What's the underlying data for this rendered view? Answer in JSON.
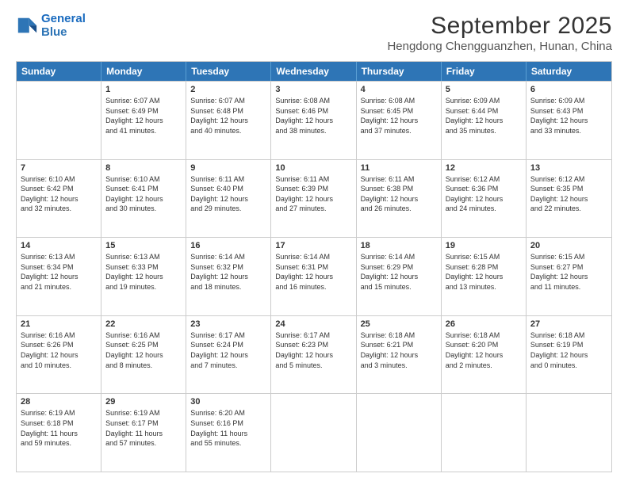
{
  "logo": {
    "line1": "General",
    "line2": "Blue"
  },
  "title": "September 2025",
  "location": "Hengdong Chengguanzhen, Hunan, China",
  "days_of_week": [
    "Sunday",
    "Monday",
    "Tuesday",
    "Wednesday",
    "Thursday",
    "Friday",
    "Saturday"
  ],
  "weeks": [
    [
      {
        "day": "",
        "info": ""
      },
      {
        "day": "1",
        "info": "Sunrise: 6:07 AM\nSunset: 6:49 PM\nDaylight: 12 hours\nand 41 minutes."
      },
      {
        "day": "2",
        "info": "Sunrise: 6:07 AM\nSunset: 6:48 PM\nDaylight: 12 hours\nand 40 minutes."
      },
      {
        "day": "3",
        "info": "Sunrise: 6:08 AM\nSunset: 6:46 PM\nDaylight: 12 hours\nand 38 minutes."
      },
      {
        "day": "4",
        "info": "Sunrise: 6:08 AM\nSunset: 6:45 PM\nDaylight: 12 hours\nand 37 minutes."
      },
      {
        "day": "5",
        "info": "Sunrise: 6:09 AM\nSunset: 6:44 PM\nDaylight: 12 hours\nand 35 minutes."
      },
      {
        "day": "6",
        "info": "Sunrise: 6:09 AM\nSunset: 6:43 PM\nDaylight: 12 hours\nand 33 minutes."
      }
    ],
    [
      {
        "day": "7",
        "info": "Sunrise: 6:10 AM\nSunset: 6:42 PM\nDaylight: 12 hours\nand 32 minutes."
      },
      {
        "day": "8",
        "info": "Sunrise: 6:10 AM\nSunset: 6:41 PM\nDaylight: 12 hours\nand 30 minutes."
      },
      {
        "day": "9",
        "info": "Sunrise: 6:11 AM\nSunset: 6:40 PM\nDaylight: 12 hours\nand 29 minutes."
      },
      {
        "day": "10",
        "info": "Sunrise: 6:11 AM\nSunset: 6:39 PM\nDaylight: 12 hours\nand 27 minutes."
      },
      {
        "day": "11",
        "info": "Sunrise: 6:11 AM\nSunset: 6:38 PM\nDaylight: 12 hours\nand 26 minutes."
      },
      {
        "day": "12",
        "info": "Sunrise: 6:12 AM\nSunset: 6:36 PM\nDaylight: 12 hours\nand 24 minutes."
      },
      {
        "day": "13",
        "info": "Sunrise: 6:12 AM\nSunset: 6:35 PM\nDaylight: 12 hours\nand 22 minutes."
      }
    ],
    [
      {
        "day": "14",
        "info": "Sunrise: 6:13 AM\nSunset: 6:34 PM\nDaylight: 12 hours\nand 21 minutes."
      },
      {
        "day": "15",
        "info": "Sunrise: 6:13 AM\nSunset: 6:33 PM\nDaylight: 12 hours\nand 19 minutes."
      },
      {
        "day": "16",
        "info": "Sunrise: 6:14 AM\nSunset: 6:32 PM\nDaylight: 12 hours\nand 18 minutes."
      },
      {
        "day": "17",
        "info": "Sunrise: 6:14 AM\nSunset: 6:31 PM\nDaylight: 12 hours\nand 16 minutes."
      },
      {
        "day": "18",
        "info": "Sunrise: 6:14 AM\nSunset: 6:29 PM\nDaylight: 12 hours\nand 15 minutes."
      },
      {
        "day": "19",
        "info": "Sunrise: 6:15 AM\nSunset: 6:28 PM\nDaylight: 12 hours\nand 13 minutes."
      },
      {
        "day": "20",
        "info": "Sunrise: 6:15 AM\nSunset: 6:27 PM\nDaylight: 12 hours\nand 11 minutes."
      }
    ],
    [
      {
        "day": "21",
        "info": "Sunrise: 6:16 AM\nSunset: 6:26 PM\nDaylight: 12 hours\nand 10 minutes."
      },
      {
        "day": "22",
        "info": "Sunrise: 6:16 AM\nSunset: 6:25 PM\nDaylight: 12 hours\nand 8 minutes."
      },
      {
        "day": "23",
        "info": "Sunrise: 6:17 AM\nSunset: 6:24 PM\nDaylight: 12 hours\nand 7 minutes."
      },
      {
        "day": "24",
        "info": "Sunrise: 6:17 AM\nSunset: 6:23 PM\nDaylight: 12 hours\nand 5 minutes."
      },
      {
        "day": "25",
        "info": "Sunrise: 6:18 AM\nSunset: 6:21 PM\nDaylight: 12 hours\nand 3 minutes."
      },
      {
        "day": "26",
        "info": "Sunrise: 6:18 AM\nSunset: 6:20 PM\nDaylight: 12 hours\nand 2 minutes."
      },
      {
        "day": "27",
        "info": "Sunrise: 6:18 AM\nSunset: 6:19 PM\nDaylight: 12 hours\nand 0 minutes."
      }
    ],
    [
      {
        "day": "28",
        "info": "Sunrise: 6:19 AM\nSunset: 6:18 PM\nDaylight: 11 hours\nand 59 minutes."
      },
      {
        "day": "29",
        "info": "Sunrise: 6:19 AM\nSunset: 6:17 PM\nDaylight: 11 hours\nand 57 minutes."
      },
      {
        "day": "30",
        "info": "Sunrise: 6:20 AM\nSunset: 6:16 PM\nDaylight: 11 hours\nand 55 minutes."
      },
      {
        "day": "",
        "info": ""
      },
      {
        "day": "",
        "info": ""
      },
      {
        "day": "",
        "info": ""
      },
      {
        "day": "",
        "info": ""
      }
    ]
  ]
}
